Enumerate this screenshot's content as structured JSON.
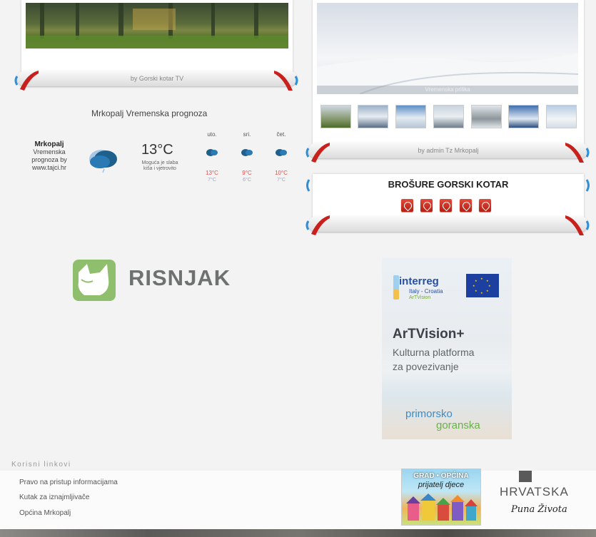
{
  "video_widget": {
    "credit": "by Gorski kotar TV"
  },
  "gallery_widget": {
    "caption": "Vremenska prilika",
    "credit": "by admin Tz Mrkopalj",
    "thumbnail_count": 7
  },
  "weather": {
    "title": "Mrkopalj Vremenska prognoza",
    "location": "Mrkopalj",
    "source_line1": "Vremenska",
    "source_line2": "prognoza by",
    "source_line3": "www.tajci.hr",
    "temperature": "13°C",
    "desc_line1": "Moguća je slaba",
    "desc_line2": "kiša i vjetrovito",
    "days": [
      {
        "name": "uto.",
        "high": "13°C",
        "low": "7°C"
      },
      {
        "name": "sri.",
        "high": "9°C",
        "low": "6°C"
      },
      {
        "name": "čet.",
        "high": "10°C",
        "low": "7°C"
      }
    ]
  },
  "brochures": {
    "title": "BROŠURE GORSKI KOTAR",
    "pdf_icon": "pdf-icon",
    "count": 5
  },
  "risnjak": {
    "name": "RISNJAK",
    "accent": "#8fbf6d"
  },
  "artvision": {
    "interreg": "interreg",
    "program": "Italy - Croatia",
    "project_tag": "ArTVision",
    "title": "ArTVision+",
    "subtitle_line1": "Kulturna platforma",
    "subtitle_line2": "za povezivanje",
    "region_part1": "primorsko",
    "region_part2": "goranska"
  },
  "footer": {
    "links_title": "Korisni linkovi",
    "links": [
      "Pravo na pristup informacijama",
      "Kutak za iznajmljivače",
      "Općina Mrkopalj"
    ],
    "badge_title": "GRAD • OPĆINA",
    "badge_sub": "prijatelj djece",
    "hrvatska": "HRVATSKA",
    "hrvatska_tagline": "Puna Života"
  },
  "colors": {
    "ribbon_red": "#c8201c",
    "ribbon_blue": "#2f8fd8",
    "pdf_red": "#d2301f"
  }
}
